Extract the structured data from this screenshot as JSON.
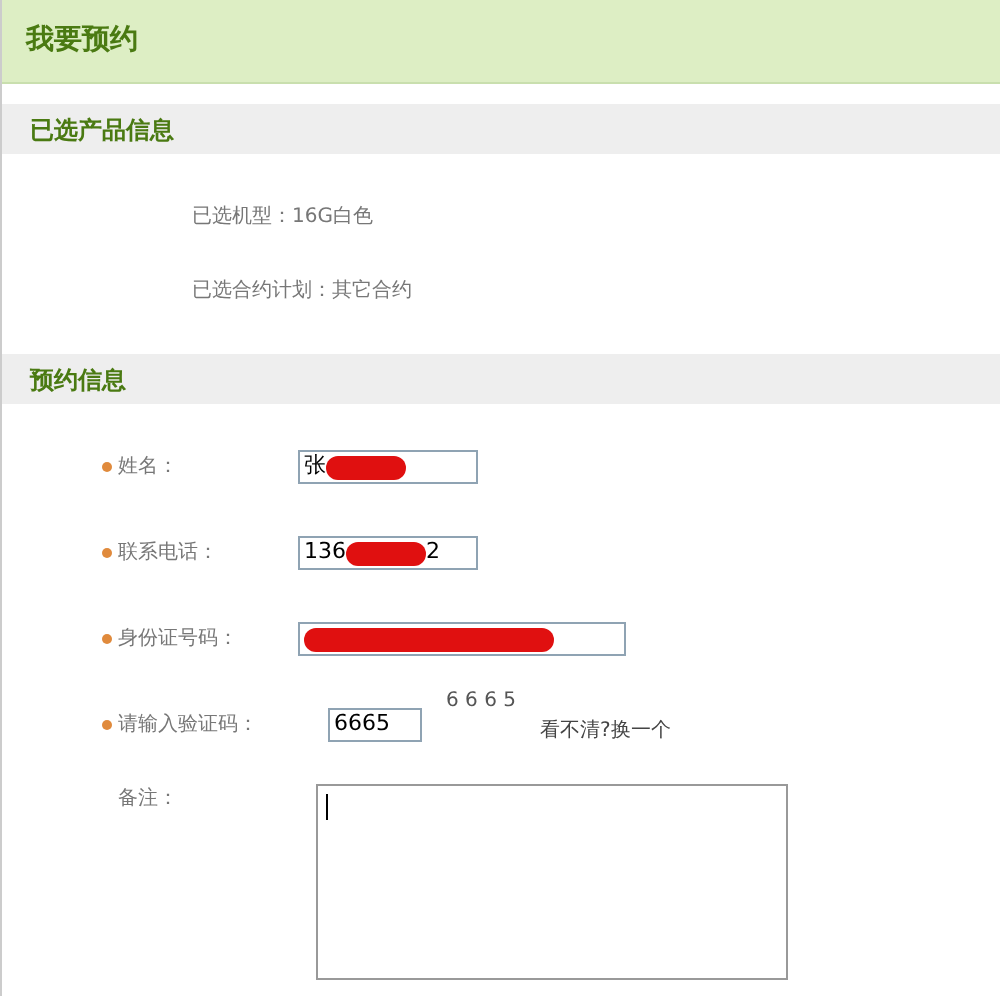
{
  "page_title": "我要预约",
  "product_section": {
    "title": "已选产品信息",
    "lines": [
      "已选机型：16G白色",
      "已选合约计划：其它合约"
    ]
  },
  "booking_section": {
    "title": "预约信息",
    "fields": [
      {
        "kind": "text",
        "required": true,
        "label": "姓名：",
        "value_start": "张",
        "redacted": true
      },
      {
        "kind": "text",
        "required": true,
        "label": "联系电话：",
        "value_start": "136",
        "redacted": true,
        "value_end": "2"
      },
      {
        "kind": "wide",
        "required": true,
        "label": "身份证号码：",
        "redacted": true
      },
      {
        "kind": "captcha",
        "required": true,
        "label": "请输入验证码：",
        "value_start": "6665",
        "redacted": false,
        "captcha": "6 6 6 5",
        "refresh_link": "看不清?换一个"
      },
      {
        "kind": "textarea",
        "required": false,
        "label": "备注：",
        "redacted": false
      }
    ]
  }
}
